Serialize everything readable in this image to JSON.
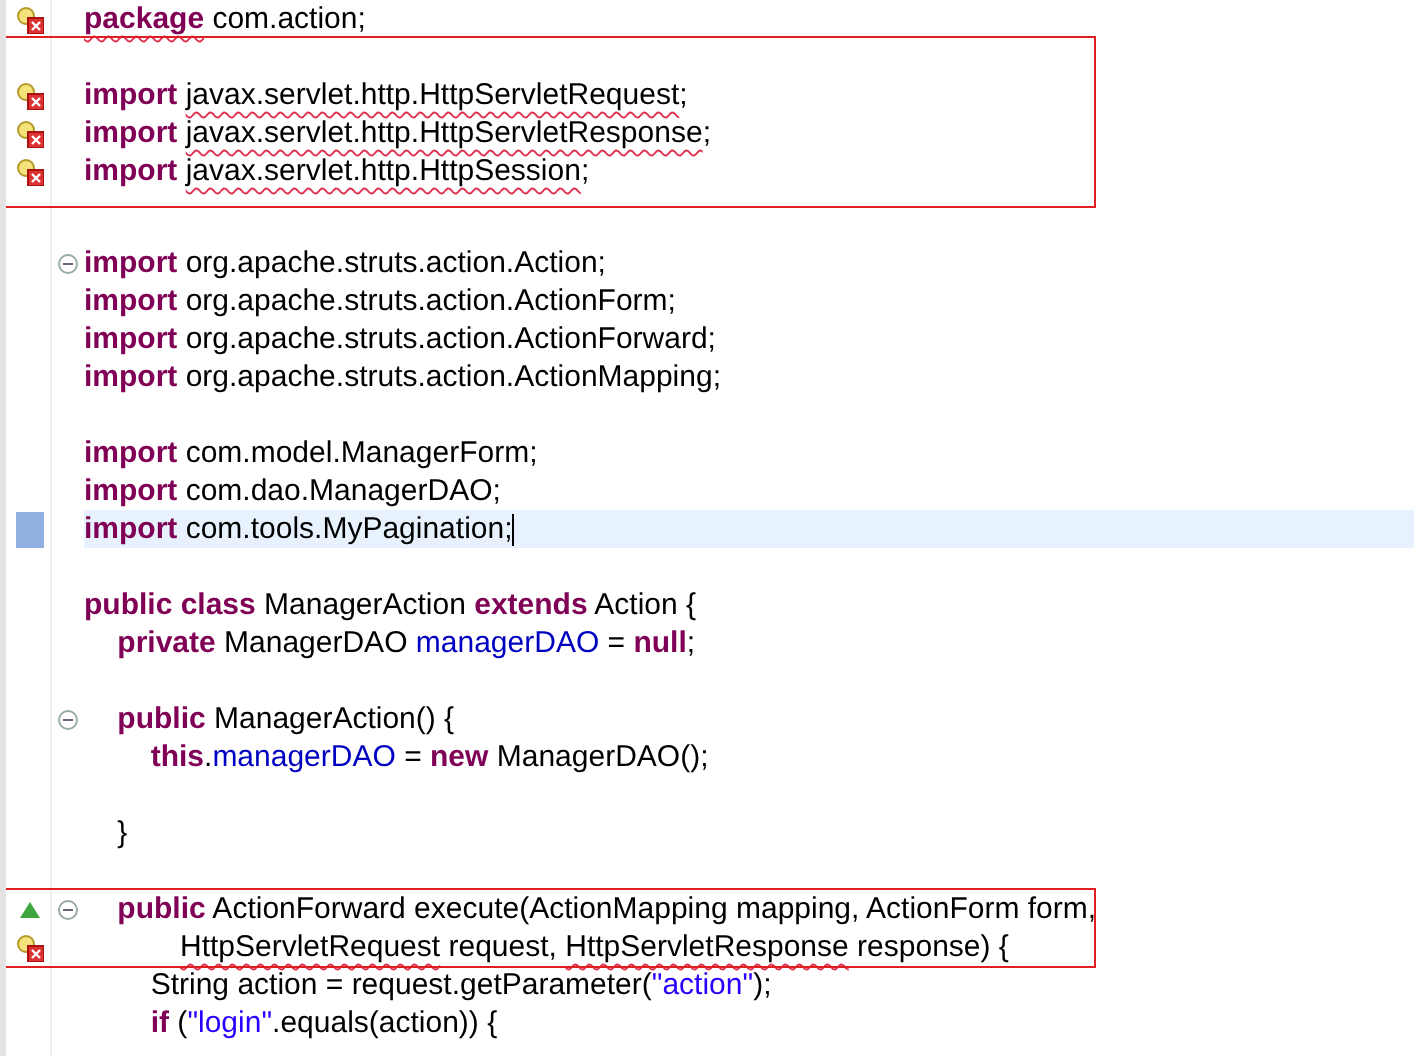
{
  "blocks": [
    {
      "lines": [
        {
          "error_marker": true,
          "tokens": [
            {
              "kind": "keyword",
              "text": "package",
              "error": true
            },
            {
              "kind": "plain",
              "text": " com.action;"
            }
          ]
        }
      ]
    },
    {
      "boxed": true,
      "lines": [
        {
          "gap_before": true,
          "error_marker": true,
          "tokens": [
            {
              "kind": "keyword",
              "text": "import "
            },
            {
              "kind": "plain",
              "text": "javax.servlet.http.HttpServletRequest",
              "error": true
            },
            {
              "kind": "plain",
              "text": ";"
            }
          ]
        },
        {
          "error_marker": true,
          "tokens": [
            {
              "kind": "keyword",
              "text": "import "
            },
            {
              "kind": "plain",
              "text": "javax.servlet.http.HttpServletResponse",
              "error": true
            },
            {
              "kind": "plain",
              "text": ";"
            }
          ]
        },
        {
          "error_marker": true,
          "tokens": [
            {
              "kind": "keyword",
              "text": "import "
            },
            {
              "kind": "plain",
              "text": "javax.servlet.http.HttpSession",
              "error": true
            },
            {
              "kind": "plain",
              "text": ";"
            }
          ]
        }
      ]
    },
    {
      "lines": [
        {
          "gap_before": true,
          "fold": true,
          "tokens": [
            {
              "kind": "keyword",
              "text": "import"
            },
            {
              "kind": "plain",
              "text": " org.apache.struts.action.Action;"
            }
          ]
        },
        {
          "tokens": [
            {
              "kind": "keyword",
              "text": "import"
            },
            {
              "kind": "plain",
              "text": " org.apache.struts.action.ActionForm;"
            }
          ]
        },
        {
          "tokens": [
            {
              "kind": "keyword",
              "text": "import"
            },
            {
              "kind": "plain",
              "text": " org.apache.struts.action.ActionForward;"
            }
          ]
        },
        {
          "tokens": [
            {
              "kind": "keyword",
              "text": "import"
            },
            {
              "kind": "plain",
              "text": " org.apache.struts.action.ActionMapping;"
            }
          ]
        },
        {
          "gap_before": true,
          "tokens": [
            {
              "kind": "keyword",
              "text": "import"
            },
            {
              "kind": "plain",
              "text": " com.model.ManagerForm;"
            }
          ]
        },
        {
          "tokens": [
            {
              "kind": "keyword",
              "text": "import"
            },
            {
              "kind": "plain",
              "text": " com.dao.ManagerDAO;"
            }
          ]
        },
        {
          "changed": true,
          "current": true,
          "tokens": [
            {
              "kind": "keyword",
              "text": "import"
            },
            {
              "kind": "plain",
              "text": " com.tools.MyPagination;"
            }
          ]
        },
        {
          "gap_before": true,
          "tokens": [
            {
              "kind": "keyword",
              "text": "public class"
            },
            {
              "kind": "plain",
              "text": " ManagerAction "
            },
            {
              "kind": "keyword",
              "text": "extends"
            },
            {
              "kind": "plain",
              "text": " Action {"
            }
          ]
        },
        {
          "tokens": [
            {
              "kind": "keyword",
              "text": "    private"
            },
            {
              "kind": "plain",
              "text": " ManagerDAO "
            },
            {
              "kind": "field",
              "text": "managerDAO"
            },
            {
              "kind": "plain",
              "text": " = "
            },
            {
              "kind": "keyword",
              "text": "null"
            },
            {
              "kind": "plain",
              "text": ";"
            }
          ]
        },
        {
          "gap_before": true,
          "fold": true,
          "tokens": [
            {
              "kind": "keyword",
              "text": "    public"
            },
            {
              "kind": "plain",
              "text": " ManagerAction() {"
            }
          ]
        },
        {
          "tokens": [
            {
              "kind": "keyword",
              "text": "        this"
            },
            {
              "kind": "plain",
              "text": "."
            },
            {
              "kind": "field",
              "text": "managerDAO"
            },
            {
              "kind": "plain",
              "text": " = "
            },
            {
              "kind": "keyword",
              "text": "new"
            },
            {
              "kind": "plain",
              "text": " ManagerDAO();"
            }
          ]
        },
        {
          "gap_before": true,
          "gap_after": true,
          "tokens": [
            {
              "kind": "plain",
              "text": "    }"
            }
          ]
        }
      ]
    },
    {
      "boxed": true,
      "lines": [
        {
          "override_marker": true,
          "fold": true,
          "tokens": [
            {
              "kind": "keyword",
              "text": "    public"
            },
            {
              "kind": "plain",
              "text": " ActionForward execute(ActionMapping mapping, ActionForm form,"
            }
          ]
        },
        {
          "error_marker": true,
          "continuation": true,
          "tokens": [
            {
              "kind": "plain",
              "text": "HttpServletRequest",
              "error": true
            },
            {
              "kind": "plain",
              "text": " request, "
            },
            {
              "kind": "plain",
              "text": "HttpServletResponse",
              "error": true
            },
            {
              "kind": "plain",
              "text": " response) {"
            }
          ]
        }
      ]
    },
    {
      "lines": [
        {
          "tokens": [
            {
              "kind": "plain",
              "text": "        String action = request.getParameter("
            },
            {
              "kind": "string",
              "text": "\"action\""
            },
            {
              "kind": "plain",
              "text": ");"
            }
          ]
        },
        {
          "tokens": [
            {
              "kind": "keyword",
              "text": "        if"
            },
            {
              "kind": "plain",
              "text": " ("
            },
            {
              "kind": "string",
              "text": "\"login\""
            },
            {
              "kind": "plain",
              "text": ".equals(action)) {"
            }
          ]
        }
      ]
    }
  ]
}
